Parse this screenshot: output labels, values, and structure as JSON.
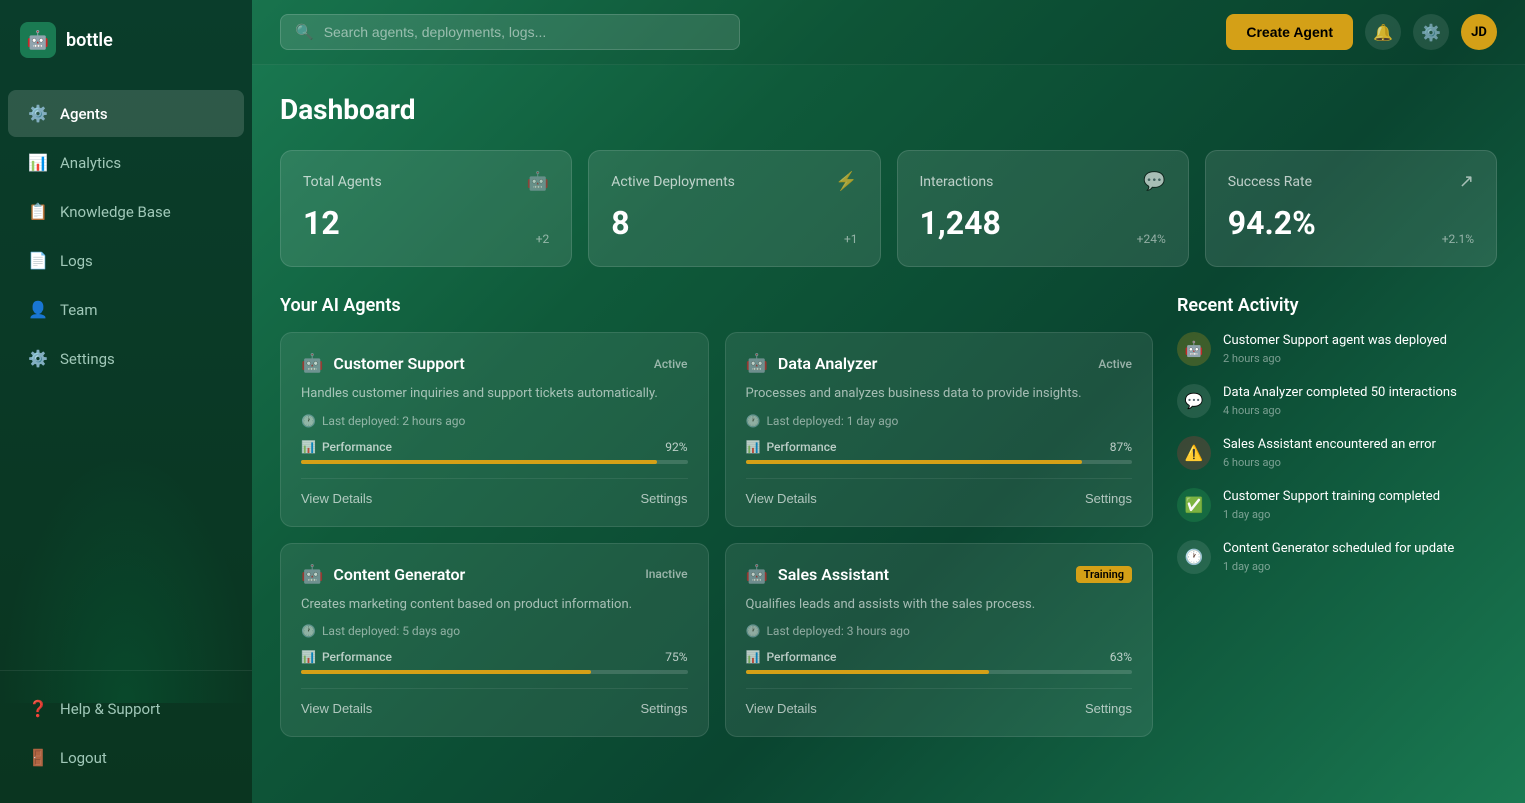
{
  "app": {
    "name": "bottle",
    "logo_emoji": "🤖",
    "user_initials": "JD"
  },
  "header": {
    "search_placeholder": "Search agents, deployments, logs...",
    "create_agent_label": "Create Agent"
  },
  "sidebar": {
    "items": [
      {
        "id": "agents",
        "label": "Agents",
        "icon": "⚙️",
        "active": true
      },
      {
        "id": "analytics",
        "label": "Analytics",
        "icon": "📊",
        "active": false
      },
      {
        "id": "knowledge-base",
        "label": "Knowledge Base",
        "icon": "📋",
        "active": false
      },
      {
        "id": "logs",
        "label": "Logs",
        "icon": "📄",
        "active": false
      },
      {
        "id": "team",
        "label": "Team",
        "icon": "👤",
        "active": false
      },
      {
        "id": "settings",
        "label": "Settings",
        "icon": "⚙️",
        "active": false
      }
    ],
    "bottom_items": [
      {
        "id": "help",
        "label": "Help & Support",
        "icon": "❓"
      },
      {
        "id": "logout",
        "label": "Logout",
        "icon": "🚪"
      }
    ]
  },
  "dashboard": {
    "title": "Dashboard",
    "stats": [
      {
        "label": "Total Agents",
        "value": "12",
        "change": "+2",
        "icon": "🤖"
      },
      {
        "label": "Active Deployments",
        "value": "8",
        "change": "+1",
        "icon": "⚡"
      },
      {
        "label": "Interactions",
        "value": "1,248",
        "change": "+24%",
        "icon": "💬"
      },
      {
        "label": "Success Rate",
        "value": "94.2%",
        "change": "+2.1%",
        "icon": "↗"
      }
    ],
    "agents_section_title": "Your AI Agents",
    "agents": [
      {
        "name": "Customer Support",
        "status": "Active",
        "status_type": "active",
        "description": "Handles customer inquiries and support tickets automatically.",
        "last_deployed": "Last deployed: 2 hours ago",
        "performance_label": "Performance",
        "performance_value": 92,
        "performance_pct": "92%",
        "view_details_label": "View Details",
        "settings_label": "Settings"
      },
      {
        "name": "Data Analyzer",
        "status": "Active",
        "status_type": "active",
        "description": "Processes and analyzes business data to provide insights.",
        "last_deployed": "Last deployed: 1 day ago",
        "performance_label": "Performance",
        "performance_value": 87,
        "performance_pct": "87%",
        "view_details_label": "View Details",
        "settings_label": "Settings"
      },
      {
        "name": "Content Generator",
        "status": "Inactive",
        "status_type": "inactive",
        "description": "Creates marketing content based on product information.",
        "last_deployed": "Last deployed: 5 days ago",
        "performance_label": "Performance",
        "performance_value": 75,
        "performance_pct": "75%",
        "view_details_label": "View Details",
        "settings_label": "Settings"
      },
      {
        "name": "Sales Assistant",
        "status": "Training",
        "status_type": "training",
        "description": "Qualifies leads and assists with the sales process.",
        "last_deployed": "Last deployed: 3 hours ago",
        "performance_label": "Performance",
        "performance_value": 63,
        "performance_pct": "63%",
        "view_details_label": "View Details",
        "settings_label": "Settings"
      }
    ],
    "activity_section_title": "Recent Activity",
    "activity": [
      {
        "text": "Customer Support agent was deployed",
        "time": "2 hours ago",
        "icon": "🤖",
        "type": "deployed"
      },
      {
        "text": "Data Analyzer completed 50 interactions",
        "time": "4 hours ago",
        "icon": "💬",
        "type": "default"
      },
      {
        "text": "Sales Assistant encountered an error",
        "time": "6 hours ago",
        "icon": "⚠️",
        "type": "error"
      },
      {
        "text": "Customer Support training completed",
        "time": "1 day ago",
        "icon": "✅",
        "type": "success"
      },
      {
        "text": "Content Generator scheduled for update",
        "time": "1 day ago",
        "icon": "🕐",
        "type": "default"
      }
    ]
  }
}
